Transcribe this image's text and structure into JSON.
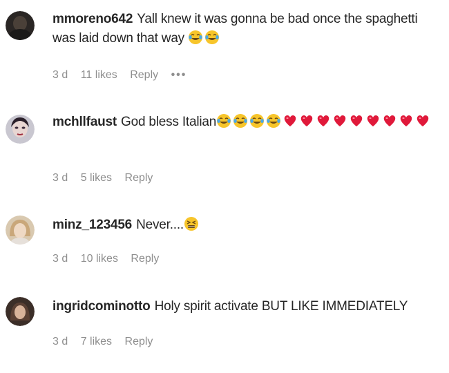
{
  "comments": [
    {
      "username": "mmoreno642",
      "text": "Yall knew it was gonna be bad once the spaghetti was laid down that way",
      "emojis": [
        "joy",
        "joy"
      ],
      "time": "3 d",
      "likes": "11 likes",
      "reply": "Reply",
      "more": "•••"
    },
    {
      "username": "mchllfaust",
      "text": "God bless Italian",
      "emojis": [
        "joy",
        "joy",
        "joy",
        "joy",
        "heart",
        "heart",
        "heart",
        "heart",
        "heart",
        "heart",
        "heart",
        "heart",
        "heart"
      ],
      "time": "3 d",
      "likes": "5 likes",
      "reply": "Reply"
    },
    {
      "username": "minz_123456",
      "text": "Never....",
      "emojis": [
        "persevere"
      ],
      "time": "3 d",
      "likes": "10 likes",
      "reply": "Reply"
    },
    {
      "username": "ingridcominotto",
      "text": "Holy spirit activate BUT LIKE IMMEDIATELY",
      "emojis": [],
      "time": "3 d",
      "likes": "7 likes",
      "reply": "Reply"
    }
  ],
  "colors": {
    "text": "#262626",
    "meta": "#8e8e8e",
    "heart": "#e0193a",
    "emoji_face": "#f7c52b"
  }
}
